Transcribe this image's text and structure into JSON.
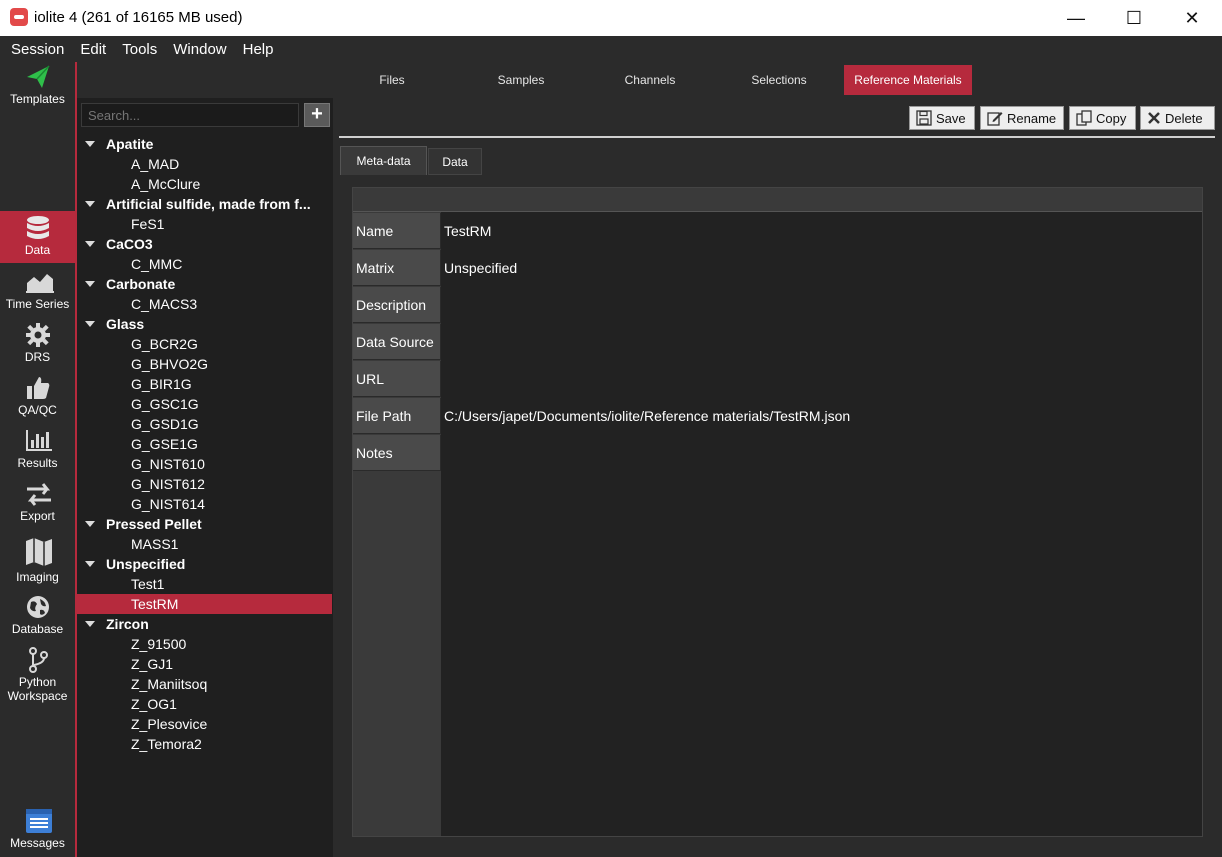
{
  "window": {
    "title": "iolite 4 (261 of 16165 MB used)",
    "minimize": "—",
    "maximize": "☐",
    "close": "✕"
  },
  "menu": [
    "Session",
    "Edit",
    "Tools",
    "Window",
    "Help"
  ],
  "rail": [
    {
      "label": "Templates",
      "icon": "paper-plane-icon"
    },
    {
      "label": "Data",
      "icon": "database-icon",
      "active": true
    },
    {
      "label": "Time Series",
      "icon": "area-chart-icon"
    },
    {
      "label": "DRS",
      "icon": "gear-icon"
    },
    {
      "label": "QA/QC",
      "icon": "thumbs-up-icon"
    },
    {
      "label": "Results",
      "icon": "bar-chart-icon"
    },
    {
      "label": "Export",
      "icon": "swap-arrows-icon"
    },
    {
      "label": "Imaging",
      "icon": "map-icon"
    },
    {
      "label": "Database",
      "icon": "globe-icon"
    },
    {
      "label": "Python\nWorkspace",
      "icon": "branch-icon"
    },
    {
      "label": "Messages",
      "icon": "messages-icon"
    }
  ],
  "top_tabs": {
    "files": "Files",
    "samples": "Samples",
    "channels": "Channels",
    "selections": "Selections",
    "reference_materials": "Reference Materials"
  },
  "search": {
    "placeholder": "Search..."
  },
  "add_button": "+",
  "tree": {
    "groups": [
      {
        "name": "Apatite",
        "items": [
          "A_MAD",
          "A_McClure"
        ]
      },
      {
        "name": "Artificial sulfide, made from f...",
        "items": [
          "FeS1"
        ]
      },
      {
        "name": "CaCO3",
        "items": [
          "C_MMC"
        ]
      },
      {
        "name": "Carbonate",
        "items": [
          "C_MACS3"
        ]
      },
      {
        "name": "Glass",
        "items": [
          "G_BCR2G",
          "G_BHVO2G",
          "G_BIR1G",
          "G_GSC1G",
          "G_GSD1G",
          "G_GSE1G",
          "G_NIST610",
          "G_NIST612",
          "G_NIST614"
        ]
      },
      {
        "name": "Pressed Pellet",
        "items": [
          "MASS1"
        ]
      },
      {
        "name": "Unspecified",
        "items": [
          "Test1",
          "TestRM"
        ]
      },
      {
        "name": "Zircon",
        "items": [
          "Z_91500",
          "Z_GJ1",
          "Z_Maniitsoq",
          "Z_OG1",
          "Z_Plesovice",
          "Z_Temora2"
        ]
      }
    ],
    "selected": "TestRM"
  },
  "actions": {
    "save": "Save",
    "rename": "Rename",
    "copy": "Copy",
    "delete": "Delete"
  },
  "sub_tabs": {
    "meta": "Meta-data",
    "data": "Data"
  },
  "form": [
    {
      "label": "Name",
      "value": "TestRM"
    },
    {
      "label": "Matrix",
      "value": "Unspecified"
    },
    {
      "label": "Description",
      "value": ""
    },
    {
      "label": "Data Source",
      "value": ""
    },
    {
      "label": "URL",
      "value": ""
    },
    {
      "label": "File Path",
      "value": "C:/Users/japet/Documents/iolite/Reference materials/TestRM.json"
    },
    {
      "label": "Notes",
      "value": ""
    }
  ],
  "colors": {
    "accent": "#b62a3d",
    "background": "#2b2b2b"
  }
}
